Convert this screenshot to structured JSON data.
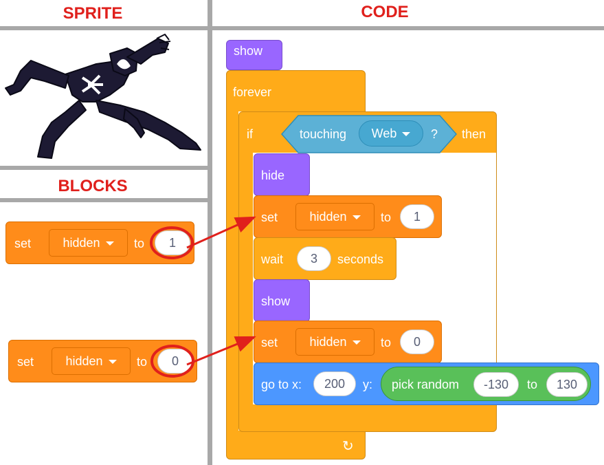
{
  "headers": {
    "sprite": "SPRITE",
    "code": "CODE",
    "blocks": "BLOCKS"
  },
  "sprite": {
    "name": "venom-sprite"
  },
  "colors": {
    "motion": "#4c97ff",
    "looks": "#9966ff",
    "control": "#ffab19",
    "variables": "#ff8c1a",
    "sensing": "#5cb1d6",
    "operators": "#59c059",
    "annotation": "#e0201c"
  },
  "palette_blocks": [
    {
      "set": "set",
      "var": "hidden",
      "to": "to",
      "value": "1"
    },
    {
      "set": "set",
      "var": "hidden",
      "to": "to",
      "value": "0"
    }
  ],
  "script": {
    "show1": "show",
    "forever": "forever",
    "if": {
      "if": "if",
      "touching": "touching",
      "target": "Web",
      "q": "?",
      "then": "then"
    },
    "hide": "hide",
    "set1": {
      "set": "set",
      "var": "hidden",
      "to": "to",
      "value": "1"
    },
    "wait": {
      "wait": "wait",
      "value": "3",
      "seconds": "seconds"
    },
    "show2": "show",
    "set2": {
      "set": "set",
      "var": "hidden",
      "to": "to",
      "value": "0"
    },
    "goto": {
      "label": "go to x:",
      "x": "200",
      "y": "y:",
      "pick": "pick random",
      "from": "-130",
      "to": "to",
      "max": "130"
    },
    "loop_icon": "↻"
  }
}
